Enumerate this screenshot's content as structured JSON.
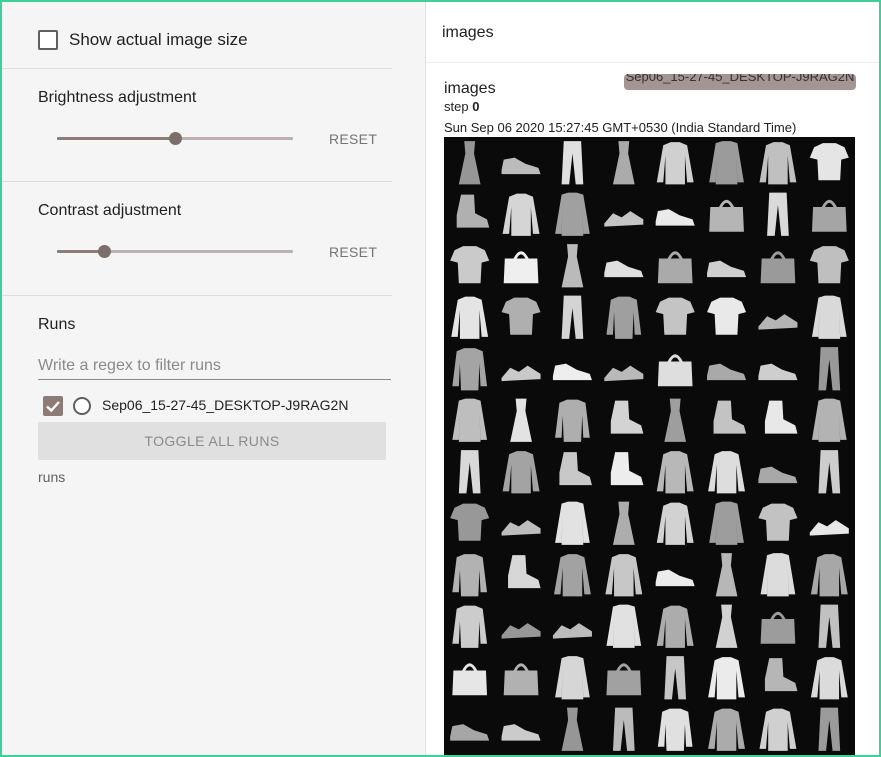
{
  "sidebar": {
    "show_actual_size_label": "Show actual image size",
    "brightness": {
      "title": "Brightness adjustment",
      "reset_label": "RESET",
      "value_fraction": 0.5
    },
    "contrast": {
      "title": "Contrast adjustment",
      "reset_label": "RESET",
      "value_fraction": 0.2
    },
    "runs": {
      "title": "Runs",
      "filter_placeholder": "Write a regex to filter runs",
      "items": [
        {
          "name": "Sep06_15-27-45_DESKTOP-J9RAG2N",
          "checked": true
        }
      ],
      "toggle_label": "TOGGLE ALL RUNS",
      "footer": "runs"
    }
  },
  "main": {
    "header": "images",
    "card": {
      "title": "images",
      "run_chip": "Sep06_15-27-45_DESKTOP-J9RAG2N",
      "step_label": "step",
      "step_value": "0",
      "timestamp": "Sun Sep 06 2020 15:27:45 GMT+0530 (India Standard Time)"
    }
  },
  "colors": {
    "accent": "#8d7b78",
    "frame_border": "#3ecf9a",
    "sidebar_bg": "#f5f5f5",
    "image_bg": "#0a0a0a"
  },
  "image_grid": {
    "columns": 8,
    "rows": 12,
    "cells": [
      "dress",
      "sneaker",
      "trouser",
      "dress",
      "pullover",
      "coat",
      "pullover",
      "tshirt",
      "ankle-boot",
      "pullover",
      "coat",
      "sandal",
      "sneaker",
      "bag",
      "trouser",
      "bag",
      "tshirt",
      "bag",
      "dress",
      "sneaker",
      "bag",
      "sneaker",
      "bag",
      "tshirt",
      "pullover",
      "tshirt",
      "trouser",
      "shirt",
      "tshirt",
      "tshirt",
      "sandal",
      "coat",
      "shirt",
      "sandal",
      "sneaker",
      "sandal",
      "bag",
      "sneaker",
      "sneaker",
      "trouser",
      "coat",
      "dress",
      "shirt",
      "ankle-boot",
      "dress",
      "ankle-boot",
      "ankle-boot",
      "coat",
      "trouser",
      "pullover",
      "ankle-boot",
      "ankle-boot",
      "pullover",
      "pullover",
      "sneaker",
      "trouser",
      "tshirt",
      "sandal",
      "coat",
      "dress",
      "pullover",
      "coat",
      "tshirt",
      "sandal",
      "shirt",
      "ankle-boot",
      "pullover",
      "pullover",
      "sneaker",
      "dress",
      "coat",
      "pullover",
      "shirt",
      "sandal",
      "sandal",
      "coat",
      "pullover",
      "dress",
      "bag",
      "trouser",
      "bag",
      "bag",
      "coat",
      "bag",
      "trouser",
      "pullover",
      "ankle-boot",
      "pullover",
      "sneaker",
      "sneaker",
      "dress",
      "trouser",
      "shirt",
      "pullover",
      "pullover",
      "trouser"
    ]
  }
}
